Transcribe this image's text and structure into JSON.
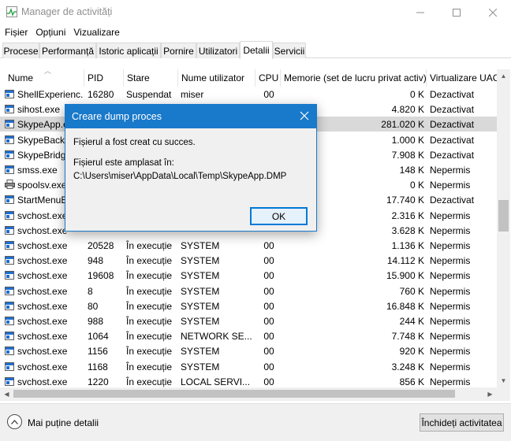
{
  "window": {
    "title": "Manager de activități",
    "min_glyph": "—",
    "max_glyph": "☐",
    "close_glyph": "✕"
  },
  "menu": [
    "Fișier",
    "Opțiuni",
    "Vizualizare"
  ],
  "tabs": [
    "Procese",
    "Performanță",
    "Istoric aplicații",
    "Pornire",
    "Utilizatori",
    "Detalii",
    "Servicii"
  ],
  "active_tab": "Detalii",
  "columns": {
    "name": "Nume",
    "pid": "PID",
    "state": "Stare",
    "user": "Nume utilizator",
    "cpu": "CPU",
    "memory": "Memorie (set de lucru privat activ)",
    "virt": "Virtualizare UAC"
  },
  "rows": [
    {
      "name": "ShellExperienc...",
      "pid": "16280",
      "state": "Suspendat",
      "user": "miser",
      "cpu": "00",
      "memory": "0 K",
      "virt": "Dezactivat",
      "icon": "process-icon"
    },
    {
      "name": "sihost.exe",
      "pid": "",
      "state": "",
      "user": "",
      "cpu": "",
      "memory": "4.820 K",
      "virt": "Dezactivat",
      "icon": "process-icon"
    },
    {
      "name": "SkypeApp.e",
      "pid": "",
      "state": "",
      "user": "",
      "cpu": "",
      "memory": "281.020 K",
      "virt": "Dezactivat",
      "icon": "process-icon",
      "selected": true
    },
    {
      "name": "SkypeBackg",
      "pid": "",
      "state": "",
      "user": "",
      "cpu": "",
      "memory": "1.000 K",
      "virt": "Dezactivat",
      "icon": "process-icon"
    },
    {
      "name": "SkypeBridg",
      "pid": "",
      "state": "",
      "user": "",
      "cpu": "",
      "memory": "7.908 K",
      "virt": "Dezactivat",
      "icon": "process-icon"
    },
    {
      "name": "smss.exe",
      "pid": "",
      "state": "",
      "user": "",
      "cpu": "",
      "memory": "148 K",
      "virt": "Nepermis",
      "icon": "process-icon"
    },
    {
      "name": "spoolsv.exe",
      "pid": "",
      "state": "",
      "user": "",
      "cpu": "",
      "memory": "0 K",
      "virt": "Nepermis",
      "icon": "printer-icon"
    },
    {
      "name": "StartMenuE",
      "pid": "",
      "state": "",
      "user": "",
      "cpu": "",
      "memory": "17.740 K",
      "virt": "Dezactivat",
      "icon": "process-icon"
    },
    {
      "name": "svchost.exe",
      "pid": "",
      "state": "",
      "user": "",
      "cpu": "",
      "memory": "2.316 K",
      "virt": "Nepermis",
      "icon": "process-icon"
    },
    {
      "name": "svchost.exe",
      "pid": "",
      "state": "",
      "user": "",
      "cpu": "",
      "memory": "3.628 K",
      "virt": "Nepermis",
      "icon": "process-icon"
    },
    {
      "name": "svchost.exe",
      "pid": "20528",
      "state": "În execuție",
      "user": "SYSTEM",
      "cpu": "00",
      "memory": "1.136 K",
      "virt": "Nepermis",
      "icon": "process-icon"
    },
    {
      "name": "svchost.exe",
      "pid": "948",
      "state": "În execuție",
      "user": "SYSTEM",
      "cpu": "00",
      "memory": "14.112 K",
      "virt": "Nepermis",
      "icon": "process-icon"
    },
    {
      "name": "svchost.exe",
      "pid": "19608",
      "state": "În execuție",
      "user": "SYSTEM",
      "cpu": "00",
      "memory": "15.900 K",
      "virt": "Nepermis",
      "icon": "process-icon"
    },
    {
      "name": "svchost.exe",
      "pid": "8",
      "state": "În execuție",
      "user": "SYSTEM",
      "cpu": "00",
      "memory": "760 K",
      "virt": "Nepermis",
      "icon": "process-icon"
    },
    {
      "name": "svchost.exe",
      "pid": "80",
      "state": "În execuție",
      "user": "SYSTEM",
      "cpu": "00",
      "memory": "16.848 K",
      "virt": "Nepermis",
      "icon": "process-icon"
    },
    {
      "name": "svchost.exe",
      "pid": "988",
      "state": "În execuție",
      "user": "SYSTEM",
      "cpu": "00",
      "memory": "244 K",
      "virt": "Nepermis",
      "icon": "process-icon"
    },
    {
      "name": "svchost.exe",
      "pid": "1064",
      "state": "În execuție",
      "user": "NETWORK SE...",
      "cpu": "00",
      "memory": "7.748 K",
      "virt": "Nepermis",
      "icon": "process-icon"
    },
    {
      "name": "svchost.exe",
      "pid": "1156",
      "state": "În execuție",
      "user": "SYSTEM",
      "cpu": "00",
      "memory": "920 K",
      "virt": "Nepermis",
      "icon": "process-icon"
    },
    {
      "name": "svchost.exe",
      "pid": "1168",
      "state": "În execuție",
      "user": "SYSTEM",
      "cpu": "00",
      "memory": "3.248 K",
      "virt": "Nepermis",
      "icon": "process-icon"
    },
    {
      "name": "svchost.exe",
      "pid": "1220",
      "state": "În execuție",
      "user": "LOCAL SERVI...",
      "cpu": "00",
      "memory": "856 K",
      "virt": "Nepermis",
      "icon": "process-icon"
    }
  ],
  "footer": {
    "fewer_details": "Mai puține detalii",
    "end_task": "Închideți activitatea"
  },
  "dialog": {
    "title": "Creare dump proces",
    "message": "Fișierul a fost creat cu succes.",
    "location_label": "Fișierul este amplasat în:",
    "path": "C:\\Users\\miser\\AppData\\Local\\Temp\\SkypeApp.DMP",
    "ok": "OK"
  },
  "colors": {
    "accent": "#1979ca",
    "selection": "#d9d9d9"
  }
}
